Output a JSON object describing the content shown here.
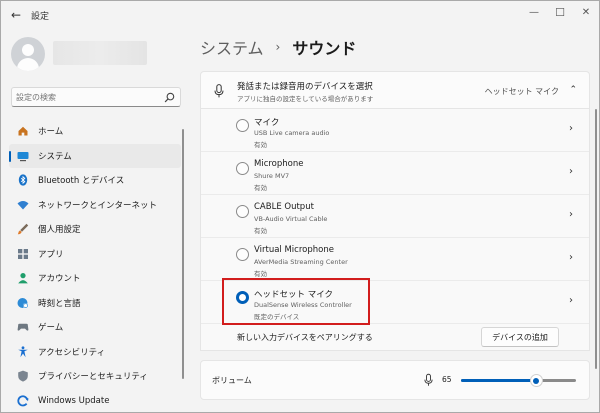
{
  "window": {
    "title": "設定",
    "back_glyph": "←",
    "minimize_glyph": "—",
    "maximize_glyph": "☐",
    "close_glyph": "✕"
  },
  "search": {
    "placeholder": "設定の検索"
  },
  "sidebar": {
    "items": [
      {
        "label": "ホーム",
        "icon": "home-icon",
        "active": false
      },
      {
        "label": "システム",
        "icon": "system-display-icon",
        "active": true
      },
      {
        "label": "Bluetooth とデバイス",
        "icon": "bluetooth-icon",
        "active": false
      },
      {
        "label": "ネットワークとインターネット",
        "icon": "wifi-icon",
        "active": false
      },
      {
        "label": "個人用設定",
        "icon": "brush-icon",
        "active": false
      },
      {
        "label": "アプリ",
        "icon": "apps-icon",
        "active": false
      },
      {
        "label": "アカウント",
        "icon": "account-icon",
        "active": false
      },
      {
        "label": "時刻と言語",
        "icon": "globe-clock-icon",
        "active": false
      },
      {
        "label": "ゲーム",
        "icon": "gamepad-icon",
        "active": false
      },
      {
        "label": "アクセシビリティ",
        "icon": "accessibility-icon",
        "active": false
      },
      {
        "label": "プライバシーとセキュリティ",
        "icon": "shield-icon",
        "active": false
      },
      {
        "label": "Windows Update",
        "icon": "update-icon",
        "active": false
      }
    ]
  },
  "breadcrumb": {
    "parent": "システム",
    "separator": "›",
    "current": "サウンド"
  },
  "input_section": {
    "title": "発話または録音用のデバイスを選択",
    "subtitle": "アプリに独自の設定をしている場合があります",
    "selected_value": "ヘッドセット マイク",
    "chevron": "⌃"
  },
  "devices": [
    {
      "name": "マイク",
      "sub": "USB Live camera audio",
      "state": "有効",
      "selected": false
    },
    {
      "name": "Microphone",
      "sub": "Shure MV7",
      "state": "有効",
      "selected": false
    },
    {
      "name": "CABLE Output",
      "sub": "VB-Audio Virtual Cable",
      "state": "有効",
      "selected": false
    },
    {
      "name": "Virtual Microphone",
      "sub": "AVerMedia Streaming Center",
      "state": "有効",
      "selected": false
    },
    {
      "name": "ヘッドセット マイク",
      "sub": "DualSense Wireless Controller",
      "state": "既定のデバイス",
      "selected": true
    }
  ],
  "pair": {
    "label": "新しい入力デバイスをペアリングする",
    "button": "デバイスの追加"
  },
  "volume": {
    "label": "ボリューム",
    "value": "65",
    "level": 0.65
  },
  "colors": {
    "accent": "#005fb8",
    "highlight": "#d21d1d"
  }
}
